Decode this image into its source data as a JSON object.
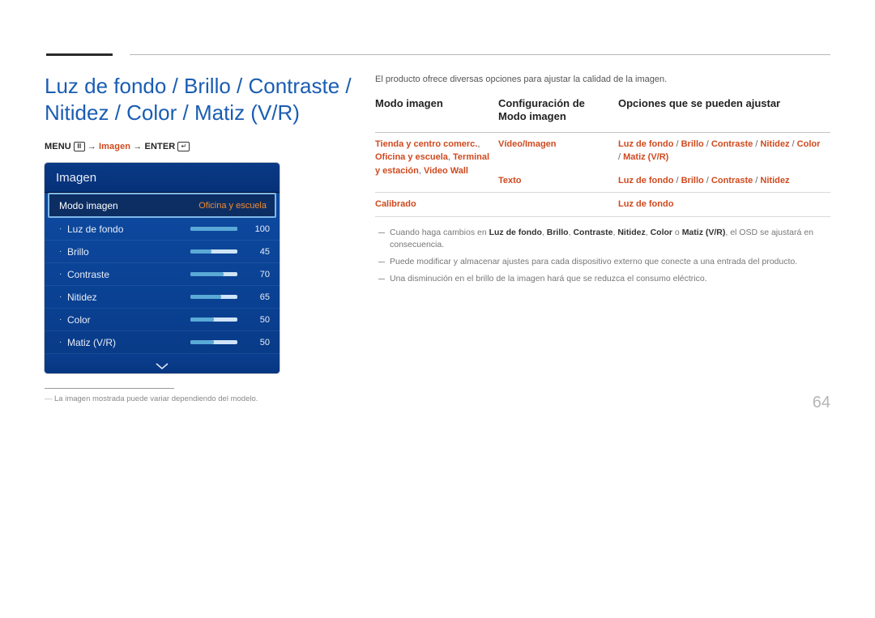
{
  "page_number": "64",
  "title": "Luz de fondo / Brillo / Contraste / Nitidez / Color / Matiz (V/R)",
  "breadcrumb": {
    "menu": "MENU",
    "imagen": "Imagen",
    "enter": "ENTER",
    "arrow": "→"
  },
  "osd": {
    "header": "Imagen",
    "selected_row": {
      "label": "Modo imagen",
      "value": "Oficina y escuela"
    },
    "rows": [
      {
        "label": "Luz de fondo",
        "value": "100",
        "pct": 100
      },
      {
        "label": "Brillo",
        "value": "45",
        "pct": 45
      },
      {
        "label": "Contraste",
        "value": "70",
        "pct": 70
      },
      {
        "label": "Nitidez",
        "value": "65",
        "pct": 65
      },
      {
        "label": "Color",
        "value": "50",
        "pct": 50
      },
      {
        "label": "Matiz (V/R)",
        "value": "50",
        "pct": 50
      }
    ]
  },
  "image_disclaimer": "La imagen mostrada puede variar dependiendo del modelo.",
  "intro": "El producto ofrece diversas opciones para ajustar la calidad de la imagen.",
  "table_headers": {
    "col1": "Modo imagen",
    "col2": "Configuración de Modo imagen",
    "col3": "Opciones que se pueden ajustar"
  },
  "table_rows": [
    {
      "col1": [
        "Tienda y centro comerc.",
        ", ",
        "Oficina y escuela",
        ", ",
        "Terminal y estación",
        ", ",
        "Video Wall"
      ],
      "col2a": "Vídeo/Imagen",
      "col3a": [
        "Luz de fondo",
        " / ",
        "Brillo",
        " / ",
        "Contraste",
        " / ",
        "Nitidez",
        " / ",
        "Color",
        " / ",
        "Matiz (V/R)"
      ],
      "col2b": "Texto",
      "col3b": [
        "Luz de fondo",
        " / ",
        "Brillo",
        " / ",
        "Contraste",
        " / ",
        "Nitidez"
      ]
    },
    {
      "col1": [
        "Calibrado"
      ],
      "col2": "",
      "col3": [
        "Luz de fondo"
      ]
    }
  ],
  "notes": [
    {
      "parts": [
        {
          "t": "Cuando haga cambios en "
        },
        {
          "b": "Luz de fondo"
        },
        {
          "t": ", "
        },
        {
          "b": "Brillo"
        },
        {
          "t": ", "
        },
        {
          "b": "Contraste"
        },
        {
          "t": ", "
        },
        {
          "b": "Nitidez"
        },
        {
          "t": ", "
        },
        {
          "b": "Color"
        },
        {
          "t": " o "
        },
        {
          "b": "Matiz (V/R)"
        },
        {
          "t": ", el OSD se ajustará en consecuencia."
        }
      ]
    },
    {
      "parts": [
        {
          "t": "Puede modificar y almacenar ajustes para cada dispositivo externo que conecte a una entrada del producto."
        }
      ]
    },
    {
      "parts": [
        {
          "t": "Una disminución en el brillo de la imagen hará que se reduzca el consumo eléctrico."
        }
      ]
    }
  ]
}
